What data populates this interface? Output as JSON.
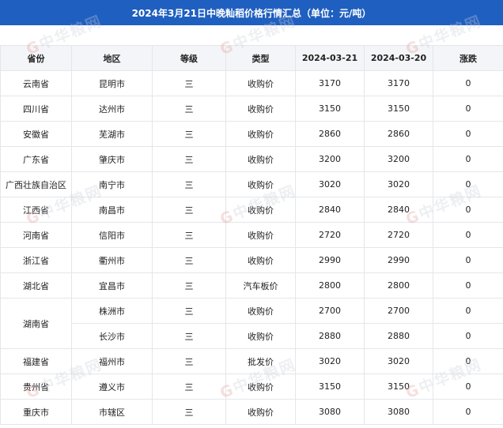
{
  "title": "2024年3月21日中晚籼稻价格行情汇总（单位：元/吨）",
  "watermark": "中华粮网",
  "headers": [
    "省份",
    "地区",
    "等级",
    "类型",
    "2024-03-21",
    "2024-03-20",
    "涨跌"
  ],
  "rows": [
    {
      "province": "云南省",
      "city": "昆明市",
      "grade": "三",
      "type": "收购价",
      "d1": "3170",
      "d2": "3170",
      "change": "0"
    },
    {
      "province": "四川省",
      "city": "达州市",
      "grade": "三",
      "type": "收购价",
      "d1": "3150",
      "d2": "3150",
      "change": "0"
    },
    {
      "province": "安徽省",
      "city": "芜湖市",
      "grade": "三",
      "type": "收购价",
      "d1": "2860",
      "d2": "2860",
      "change": "0"
    },
    {
      "province": "广东省",
      "city": "肇庆市",
      "grade": "三",
      "type": "收购价",
      "d1": "3200",
      "d2": "3200",
      "change": "0"
    },
    {
      "province": "广西壮族自治区",
      "city": "南宁市",
      "grade": "三",
      "type": "收购价",
      "d1": "3020",
      "d2": "3020",
      "change": "0"
    },
    {
      "province": "江西省",
      "city": "南昌市",
      "grade": "三",
      "type": "收购价",
      "d1": "2840",
      "d2": "2840",
      "change": "0"
    },
    {
      "province": "河南省",
      "city": "信阳市",
      "grade": "三",
      "type": "收购价",
      "d1": "2720",
      "d2": "2720",
      "change": "0"
    },
    {
      "province": "浙江省",
      "city": "衢州市",
      "grade": "三",
      "type": "收购价",
      "d1": "2990",
      "d2": "2990",
      "change": "0"
    },
    {
      "province": "湖北省",
      "city": "宜昌市",
      "grade": "三",
      "type": "汽车板价",
      "d1": "2800",
      "d2": "2800",
      "change": "0"
    },
    {
      "province": "湖南省",
      "city": "株洲市",
      "grade": "三",
      "type": "收购价",
      "d1": "2700",
      "d2": "2700",
      "change": "0"
    },
    {
      "province": "",
      "city": "长沙市",
      "grade": "三",
      "type": "收购价",
      "d1": "2880",
      "d2": "2880",
      "change": "0"
    },
    {
      "province": "福建省",
      "city": "福州市",
      "grade": "三",
      "type": "批发价",
      "d1": "3020",
      "d2": "3020",
      "change": "0"
    },
    {
      "province": "贵州省",
      "city": "遵义市",
      "grade": "三",
      "type": "收购价",
      "d1": "3150",
      "d2": "3150",
      "change": "0"
    },
    {
      "province": "重庆市",
      "city": "市辖区",
      "grade": "三",
      "type": "收购价",
      "d1": "3080",
      "d2": "3080",
      "change": "0"
    }
  ],
  "colors": {
    "title_bg": "#1f5fbf",
    "title_text": "#ffffff",
    "header_bg": "#f4f5f8",
    "border": "#e4e6ea"
  }
}
